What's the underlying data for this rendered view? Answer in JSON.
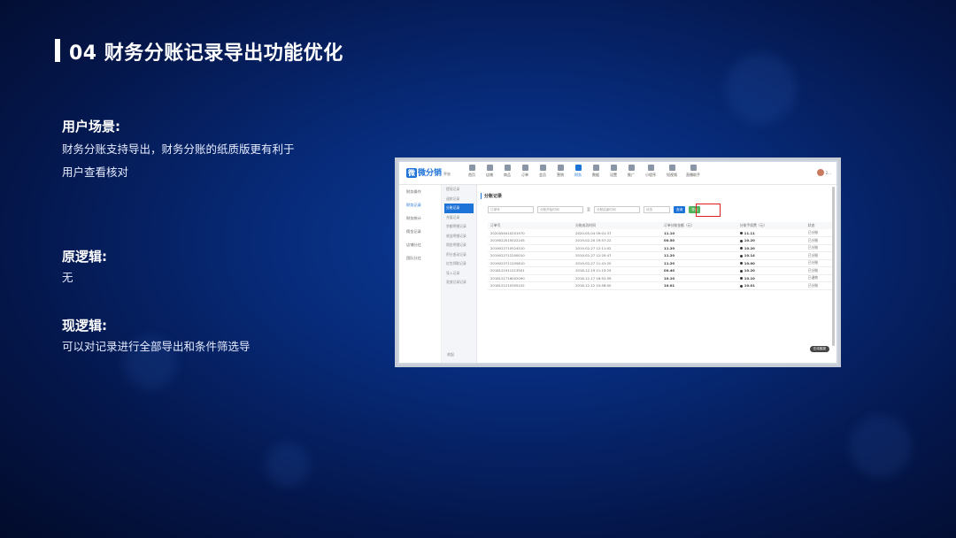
{
  "slide": {
    "title": "04 财务分账记录导出功能优化",
    "sections": [
      {
        "heading": "用户场景:",
        "lines": [
          "财务分账支持导出，财务分账的纸质版更有利于",
          "用户查看核对"
        ]
      },
      {
        "heading": "原逻辑:",
        "lines": [
          "无"
        ]
      },
      {
        "heading": "现逻辑:",
        "lines": [
          "可以对记录进行全部导出和条件筛选导"
        ]
      }
    ]
  },
  "app": {
    "logo": "微分销",
    "logo_sub": "平台",
    "nav": [
      "首页",
      "店铺",
      "商品",
      "订单",
      "会员",
      "营销",
      "财务",
      "数据",
      "设置",
      "推广"
    ],
    "nav_active_index": 6,
    "nav_extra": [
      "小程序",
      "短视频",
      "直播助手"
    ],
    "user": "2...",
    "sidebar1": [
      "财务操作",
      "财务记录",
      "财务统计",
      "佣金记录",
      "店铺分红",
      "团队分红"
    ],
    "sidebar1_active_index": 1,
    "sidebar2": [
      "提现记录",
      "退款记录",
      "分账记录",
      "充值记录",
      "余额明细记录",
      "收益明细记录",
      "佣金明细记录",
      "积分变动记录",
      "红包领取记录",
      "导入记录",
      "发放记录记录"
    ],
    "sidebar2_active_index": 2,
    "collapse": "收起",
    "page_title": "分账记录",
    "filters": {
      "order_no": "订单号",
      "start": "分账开始时间",
      "to": "至",
      "end": "分账结束时间",
      "status": "状态",
      "search": "查询",
      "export": "导出"
    },
    "table": {
      "headers": [
        "订单号",
        "分账成功时间",
        "订单分账金额（元）",
        "分账手续费（元）",
        "状态"
      ],
      "rows": [
        [
          "2020050410201970",
          "2020-05-04 09:01:37",
          "11.10",
          "11.11",
          "已分账"
        ],
        [
          "2019022015022245",
          "2019-02-20 19:57:22",
          "00.50",
          "10.20",
          "已分账"
        ],
        [
          "2019022710524510",
          "2019-02-27 12:11:02",
          "11.20",
          "10.20",
          "已分账"
        ],
        [
          "2019022712200010",
          "2019-02-27 12:20:47",
          "11.20",
          "10.14",
          "已分账"
        ],
        [
          "2019022711205810",
          "2019-02-27 11:41:20",
          "11.20",
          "10.00",
          "已分账"
        ],
        [
          "2018121911213501",
          "2018-12-19 11:15:25",
          "00.40",
          "10.20",
          "已分账"
        ],
        [
          "2018121716002090",
          "2018-12-17 16:52:59",
          "10.10",
          "10.10",
          "已退款"
        ],
        [
          "2018121210305102",
          "2018-12-12 10:58:00",
          "10.01",
          "10.01",
          "已分账"
        ]
      ]
    },
    "chat": "在线客服"
  }
}
